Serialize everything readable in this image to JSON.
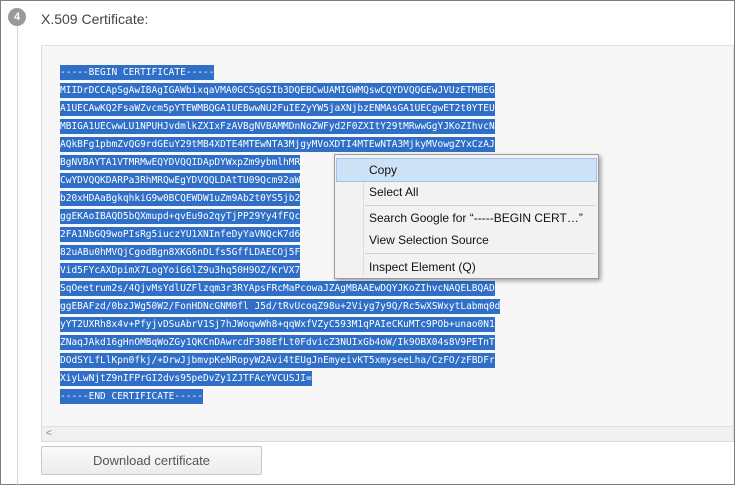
{
  "step": {
    "number": "4",
    "title": "X.509 Certificate:"
  },
  "certificate": {
    "lines": [
      "-----BEGIN CERTIFICATE-----",
      "MIIDrDCCApSgAwIBAgIGAWbixqaVMA0GCSqGSIb3DQEBCwUAMIGWMQswCQYDVQQGEwJVUzETMBEG",
      "A1UECAwKQ2FsaWZvcm5pYTEWMBQGA1UEBwwNU2FuIEZyYW5jaXNjbzENMAsGA1UECgwET2t0YTEU",
      "MBIGA1UECwwLU1NPUHJvdmlkZXIxFzAVBgNVBAMMDnNoZWFyd2F0ZXItY29tMRwwGgYJKoZIhvcN",
      "AQkBFg1pbmZvQG9rdGEuY29tMB4XDTE4MTEwNTA3MjgyMVoXDTI4MTEwNTA3MjkyMVowgZYxCzAJ",
      "BgNVBAYTA1VTMRMwEQYDVQQIDApDYWxpZm9ybmlhMR",
      "CwYDVQQKDARPa3RhMRQwEgYDVQQLDAtTU09Qcm92aW",
      "b20xHDAaBgkqhkiG9w0BCQEWDW1uZm9Ab2t0YS5jb2",
      "ggEKAoIBAQD5bQXmupd+qvEu9o2qyTjPP29Yy4fFQc",
      "2FA1NbGQ9woPIsRg5iuczYU1XNInfeDyYaVNQcK7d6",
      "82uABu0hMVQjCgodBgn8XKG6nDLfs5GffLDAECOj5F",
      "Vid5FYcAXDpimX7LogYoiG6lZ9u3hq50H9OZ/KrVX7",
      "SqOeetrum2s/4QjvMsYdlUZFlzqm3r3RYApsFRcMaPcowaJZAgMBAAEwDQYJKoZIhvcNAQELBQAD",
      "ggEBAFzd/0bzJWg50W2/FonHDNcGNM0fl J5d/tRvUcoqZ98u+2Viyg7y9Q/Rc5wXSWxytLabmq0d",
      "yYT2UXRh8x4v+PfyjvDSuAbrV1Sj7hJWoqwWh8+qqWxfVZyC593M1qPAIeCKuMTc9POb+unao0N1",
      "ZNaqJAkd16gHnOMBqWoZGy1QKCnDAwrcdF308EfLt0FdvicZ3NUIxGb4oW/Ik9OBX04s8V9PETnT",
      "DOdSYLfLlKpn0fkj/+DrwJjbmvpKeNRopyW2Avi4tEUgJnEmyeivKT5xmyseeLha/CzFO/zFBDFr",
      "XiyLwNjtZ9nIFPrGI2dvs95peDvZy1ZJTFAcYVCUSJI=",
      "-----END CERTIFICATE-----"
    ]
  },
  "scrollbar": {
    "left_arrow": "<"
  },
  "download_button": {
    "label": "Download certificate"
  },
  "context_menu": {
    "copy": "Copy",
    "select_all": "Select All",
    "search_google": "Search Google for “-----BEGIN CERT…”",
    "view_source": "View Selection Source",
    "inspect": "Inspect Element (Q)"
  },
  "colors": {
    "selection": "#2f6fc7",
    "menu_highlight": "#cde1f7"
  }
}
